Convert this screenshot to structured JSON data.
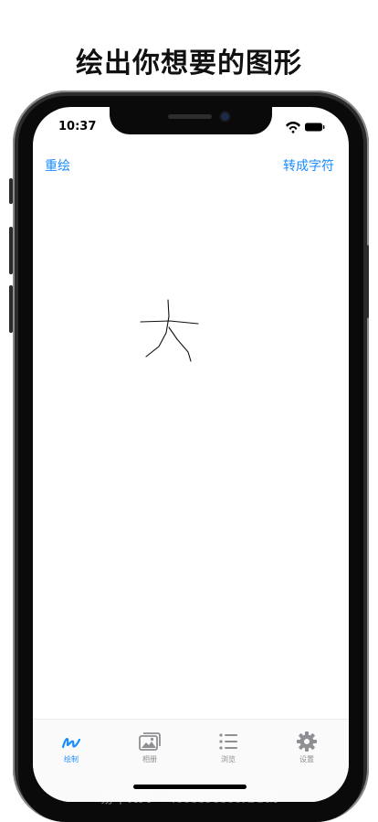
{
  "headline": "绘出你想要的图形",
  "status_bar": {
    "time": "10:37"
  },
  "nav": {
    "left_button": "重绘",
    "right_button": "转成字符"
  },
  "canvas": {
    "drawn_character": "大"
  },
  "tab_bar": {
    "tabs": [
      {
        "label": "绘制",
        "icon": "draw-icon",
        "active": true
      },
      {
        "label": "相册",
        "icon": "photo-album-icon",
        "active": false
      },
      {
        "label": "浏览",
        "icon": "list-icon",
        "active": false
      },
      {
        "label": "设置",
        "icon": "gear-icon",
        "active": false
      }
    ]
  },
  "colors": {
    "accent": "#1a8cff",
    "inactive": "#8e8e93",
    "ink": "#000000"
  },
  "watermark": "易下APP・4008891800.COM"
}
